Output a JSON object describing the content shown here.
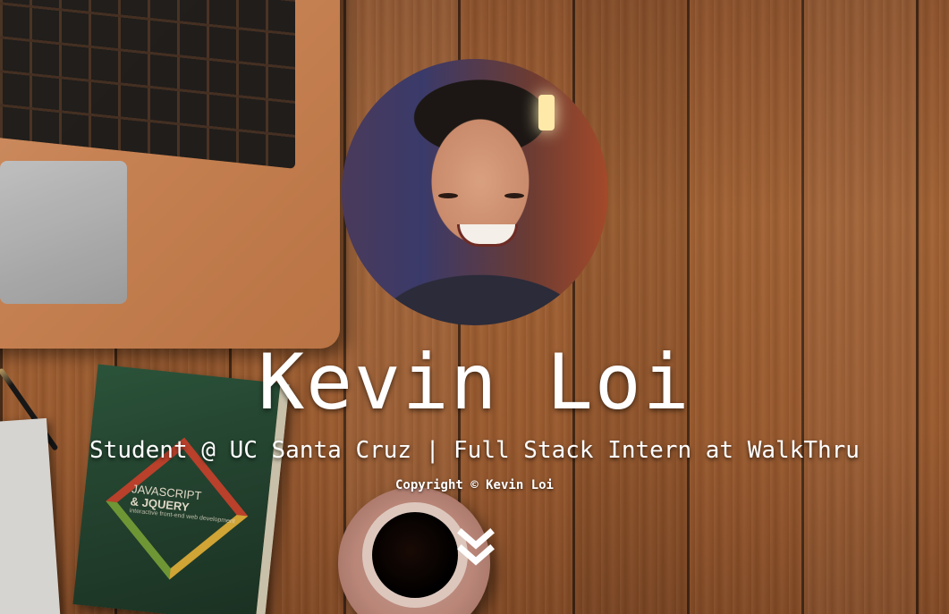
{
  "profile": {
    "name": "Kevin Loi",
    "tagline": "Student @ UC Santa Cruz | Full Stack Intern at WalkThru",
    "copyright": "Copyright © Kevin Loi"
  },
  "book": {
    "title_line1": "JAVASCRIPT",
    "title_line2": "& JQUERY",
    "subtitle": "interactive front-end web development"
  },
  "icons": {
    "scroll_down": "double-chevron-down-icon"
  },
  "colors": {
    "text": "#ffffff",
    "wood": "#a86232"
  }
}
